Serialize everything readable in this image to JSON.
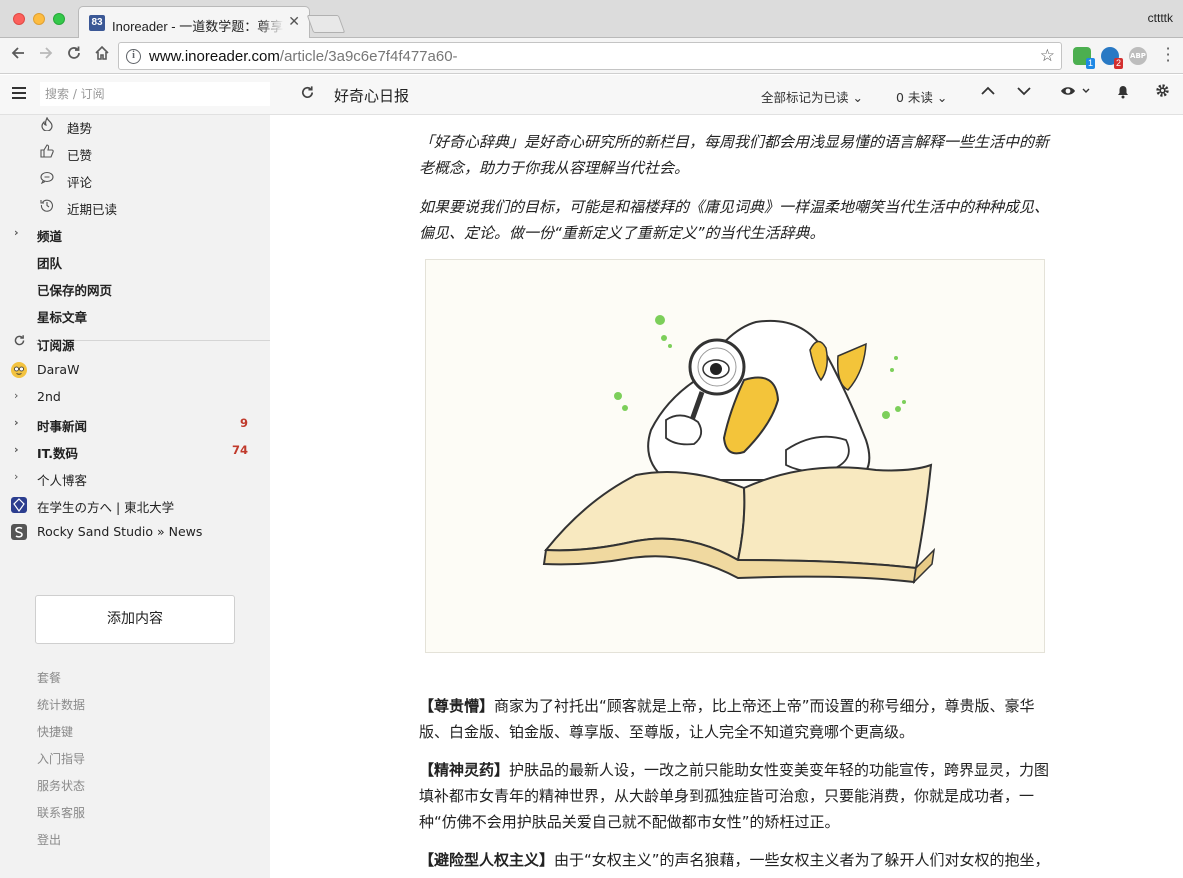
{
  "browser": {
    "tab_badge": "83",
    "tab_title": "Inoreader - 一道数学题：尊享尊贵",
    "tab_close": "✕",
    "profile_name": "cttttk",
    "url_host": "www.inoreader.com",
    "url_path": "/article/3a9c6e7f4f477a60-",
    "ext_badges": [
      "1",
      "2"
    ],
    "ext_abp": "ABP"
  },
  "header": {
    "search_placeholder": "搜索 / 订阅",
    "feed_title": "好奇心日报",
    "mark_all_read": "全部标记为已读 ⌄",
    "unread_count": "0 未读 ⌄"
  },
  "sidebar": {
    "items": [
      {
        "label": "趋势",
        "icon": "flame-icon"
      },
      {
        "label": "已赞",
        "icon": "thumbs-up-icon"
      },
      {
        "label": "评论",
        "icon": "comment-icon"
      },
      {
        "label": "近期已读",
        "icon": "history-icon"
      }
    ],
    "sections": [
      {
        "label": "频道",
        "has_chevron": true
      },
      {
        "label": "团队",
        "has_chevron": false
      },
      {
        "label": "已保存的网页",
        "has_chevron": false
      },
      {
        "label": "星标文章",
        "has_chevron": false
      }
    ],
    "subscriptions_label": "订阅源",
    "feeds": [
      {
        "label": "DaraW",
        "count": ""
      },
      {
        "label": "2nd",
        "count": ""
      },
      {
        "label": "时事新闻",
        "count": "9"
      },
      {
        "label": "IT.数码",
        "count": "74"
      },
      {
        "label": "个人博客",
        "count": ""
      },
      {
        "label": "在学生の方へ | 東北大学",
        "count": ""
      },
      {
        "label": "Rocky Sand Studio » News",
        "count": ""
      }
    ],
    "add_content": "添加内容",
    "footer_links": [
      "套餐",
      "统计数据",
      "快捷键",
      "入门指导",
      "服务状态",
      "联系客服",
      "登出"
    ]
  },
  "article": {
    "intro_1": "「好奇心辞典」是好奇心研究所的新栏目，每周我们都会用浅显易懂的语言解释一些生活中的新老概念，助力于你我从容理解当代社会。",
    "intro_2": "如果要说我们的目标，可能是和福楼拜的《庸见词典》一样温柔地嘲笑当代生活中的种种成见、偏见、定论。做一份“重新定义了重新定义”的当代生活辞典。",
    "entries": [
      {
        "term": "【尊贵懵】",
        "text": "商家为了衬托出“顾客就是上帝，比上帝还上帝”而设置的称号细分，尊贵版、豪华版、白金版、铂金版、尊享版、至尊版，让人完全不知道究竟哪个更高级。"
      },
      {
        "term": "【精神灵药】",
        "text": "护肤品的最新人设，一改之前只能助女性变美变年轻的功能宣传，跨界显灵，力图填补都市女青年的精神世界，从大龄单身到孤独症皆可治愈，只要能消费，你就是成功者，一种“仿佛不会用护肤品关爱自己就不配做都市女性”的矫枉过正。"
      },
      {
        "term": "【避险型人权主义】",
        "text": "由于“女权主义”的声名狼藉，一些女权主义者为了躲开人们对女权的抱坐，更改称自己是人权主义的，种王奈的迁化自保行为"
      }
    ]
  }
}
